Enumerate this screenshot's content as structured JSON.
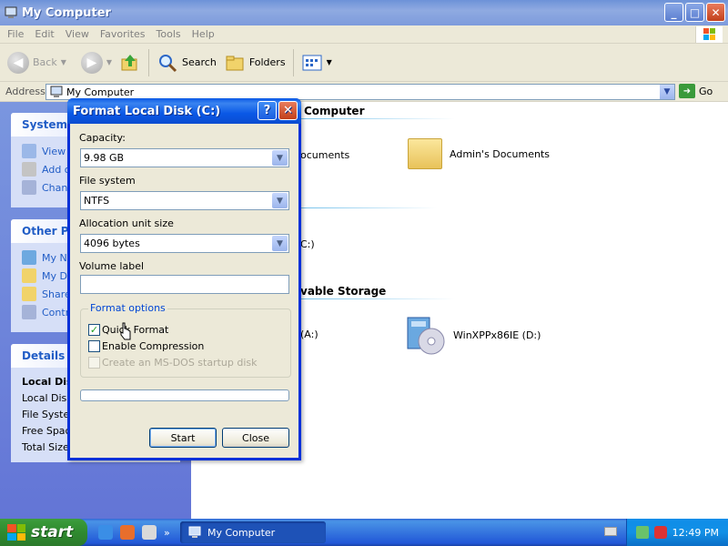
{
  "window": {
    "title": "My Computer",
    "minimize": "_",
    "maximize": "□",
    "close": "✕"
  },
  "menu": [
    "File",
    "Edit",
    "View",
    "Favorites",
    "Tools",
    "Help"
  ],
  "toolbar": {
    "back": "Back",
    "search": "Search",
    "folders": "Folders"
  },
  "address": {
    "label": "Address",
    "value": "My Computer",
    "go": "Go"
  },
  "left_panels": {
    "system_tasks": {
      "title": "System T",
      "items": [
        "View",
        "Add o",
        "Chan"
      ]
    },
    "other_places": {
      "title": "Other Pla",
      "items": [
        "My Ne",
        "My Do",
        "Share",
        "Contr"
      ]
    },
    "details": {
      "title": "Details",
      "items": [
        "Local Dis",
        "Local Disk",
        "File Syster",
        "Free Spac",
        "Total Size"
      ]
    }
  },
  "main": {
    "group1": "Computer",
    "group1_items": [
      {
        "label": "ocuments"
      },
      {
        "label": "Admin's Documents"
      }
    ],
    "drive_c": "C:)",
    "group2": "vable Storage",
    "floppy": "(A:)",
    "cd_drive": "WinXPPx86IE (D:)"
  },
  "dialog": {
    "title": "Format Local Disk (C:)",
    "help": "?",
    "close": "✕",
    "capacity_label": "Capacity:",
    "capacity_value": "9.98 GB",
    "fs_label": "File system",
    "fs_value": "NTFS",
    "alloc_label": "Allocation unit size",
    "alloc_value": "4096 bytes",
    "volume_label": "Volume label",
    "volume_value": "",
    "options_legend": "Format options",
    "quick_format": "Quick Format",
    "quick_format_checked": true,
    "enable_compression": "Enable Compression",
    "enable_compression_checked": false,
    "msdos_disk": "Create an MS-DOS startup disk",
    "start": "Start",
    "close_btn": "Close"
  },
  "taskbar": {
    "start": "start",
    "task": "My Computer",
    "time": "12:49 PM",
    "chevron": "»"
  }
}
